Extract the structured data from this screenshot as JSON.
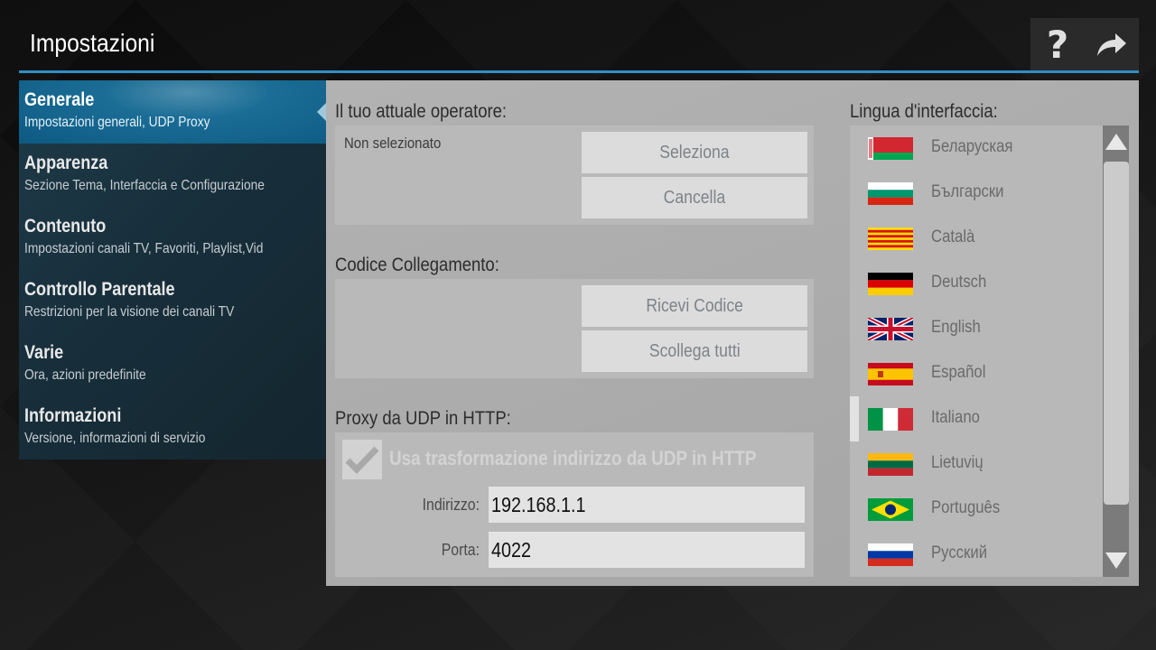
{
  "header": {
    "title": "Impostazioni",
    "help_icon": "question-mark-icon",
    "exit_icon": "forward-arrow-icon",
    "accent_color": "#2f8fc4"
  },
  "sidebar": {
    "items": [
      {
        "title": "Generale",
        "subtitle": "Impostazioni generali, UDP Proxy",
        "active": true
      },
      {
        "title": "Apparenza",
        "subtitle": "Sezione Tema, Interfaccia e Configurazione",
        "active": false
      },
      {
        "title": "Contenuto",
        "subtitle": "Impostazioni canali TV, Favoriti, Playlist,Vid",
        "active": false
      },
      {
        "title": "Controllo Parentale",
        "subtitle": "Restrizioni per la visione dei canali TV",
        "active": false
      },
      {
        "title": "Varie",
        "subtitle": "Ora, azioni predefinite",
        "active": false
      },
      {
        "title": "Informazioni",
        "subtitle": "Versione, informazioni di servizio",
        "active": false
      }
    ]
  },
  "operator": {
    "title": "Il tuo attuale operatore:",
    "value": "Non selezionato",
    "select_label": "Seleziona",
    "cancel_label": "Cancella"
  },
  "link_code": {
    "title": "Codice Collegamento:",
    "receive_label": "Ricevi Codice",
    "unlink_label": "Scollega tutti"
  },
  "udp_proxy": {
    "title": "Proxy da UDP in HTTP:",
    "checkbox_label": "Usa trasformazione indirizzo da UDP in HTTP",
    "checkbox_checked": true,
    "address_label": "Indirizzo:",
    "address_value": "192.168.1.1",
    "port_label": "Porta:",
    "port_value": "4022"
  },
  "language": {
    "title": "Lingua d'interfaccia:",
    "selected": "Italiano",
    "items": [
      {
        "name": "Беларуская",
        "flag": "flag-belarus-icon"
      },
      {
        "name": "Български",
        "flag": "flag-bulgaria-icon"
      },
      {
        "name": "Català",
        "flag": "flag-catalonia-icon"
      },
      {
        "name": "Deutsch",
        "flag": "flag-germany-icon"
      },
      {
        "name": "English",
        "flag": "flag-uk-icon"
      },
      {
        "name": "Español",
        "flag": "flag-spain-icon"
      },
      {
        "name": "Italiano",
        "flag": "flag-italy-icon"
      },
      {
        "name": "Lietuvių",
        "flag": "flag-lithuania-icon"
      },
      {
        "name": "Português",
        "flag": "flag-brazil-icon"
      },
      {
        "name": "Русский",
        "flag": "flag-russia-icon"
      }
    ]
  }
}
